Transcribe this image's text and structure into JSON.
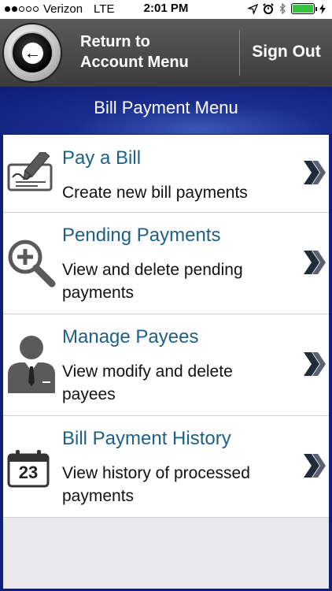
{
  "status_bar": {
    "carrier": "Verizon",
    "network": "LTE",
    "time": "2:01 PM",
    "battery_level": 1.0
  },
  "header": {
    "return_label_line1": "Return to",
    "return_label_line2": "Account Menu",
    "sign_out_label": "Sign Out"
  },
  "menu": {
    "title": "Bill Payment Menu",
    "items": [
      {
        "title": "Pay a Bill",
        "desc_line1": "Create new bill payments",
        "desc_line2": "",
        "icon": "pen-check-icon"
      },
      {
        "title": "Pending Payments",
        "desc_line1": "View and delete pending",
        "desc_line2": "payments",
        "icon": "magnify-plus-icon"
      },
      {
        "title": "Manage Payees",
        "desc_line1": "View modify and delete",
        "desc_line2": "payees",
        "icon": "person-icon"
      },
      {
        "title": "Bill Payment History",
        "desc_line1": "View history of processed",
        "desc_line2": "payments",
        "icon": "calendar-icon",
        "calendar_day": "23"
      }
    ]
  },
  "colors": {
    "title_blue": "#1f5f86",
    "header_gray": "#4a4a4a",
    "band_blue": "#1a2d8f",
    "chevron": "#1f2c3a"
  }
}
